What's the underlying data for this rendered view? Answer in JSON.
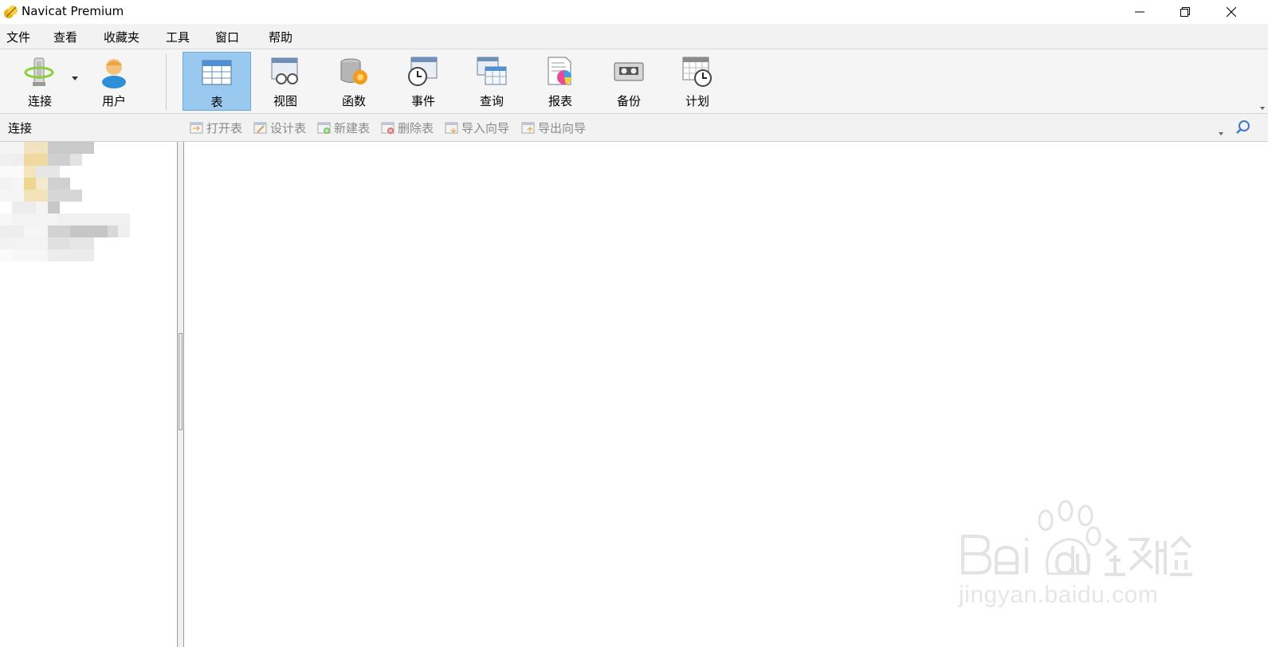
{
  "window": {
    "title": "Navicat Premium",
    "controls": [
      "minimize",
      "restore",
      "close"
    ]
  },
  "menu": {
    "items": [
      "文件",
      "查看",
      "收藏夹",
      "工具",
      "窗口",
      "帮助"
    ]
  },
  "toolbar": {
    "buttons": [
      {
        "label": "连接",
        "icon": "connection-icon"
      },
      {
        "label": "用户",
        "icon": "user-icon"
      },
      {
        "label": "表",
        "icon": "table-icon",
        "active": true
      },
      {
        "label": "视图",
        "icon": "view-icon"
      },
      {
        "label": "函数",
        "icon": "function-icon"
      },
      {
        "label": "事件",
        "icon": "event-icon"
      },
      {
        "label": "查询",
        "icon": "query-icon"
      },
      {
        "label": "报表",
        "icon": "report-icon"
      },
      {
        "label": "备份",
        "icon": "backup-icon"
      },
      {
        "label": "计划",
        "icon": "schedule-icon"
      }
    ]
  },
  "object_toolbar": {
    "section_label": "连接",
    "actions": [
      "打开表",
      "设计表",
      "新建表",
      "删除表",
      "导入向导",
      "导出向导"
    ]
  },
  "watermark": {
    "logo_text": "Baidu经验",
    "url": "jingyan.baidu.com"
  },
  "colors": {
    "active_button_bg": "#99c9ef",
    "toolbar_bg": "#f5f5f5",
    "disabled_text": "#8a8a8a"
  }
}
